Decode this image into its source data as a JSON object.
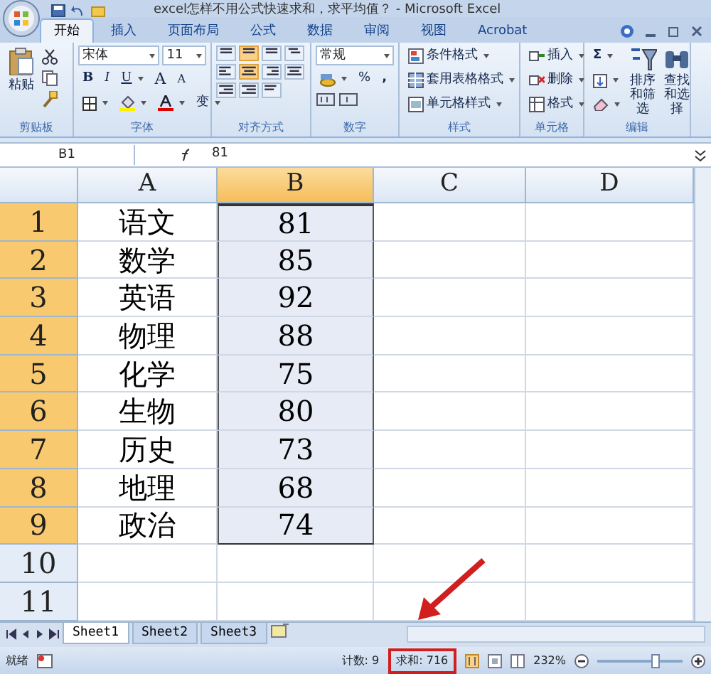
{
  "window": {
    "title": "excel怎样不用公式快速求和，求平均值？ - Microsoft Excel"
  },
  "ribbon_tabs": [
    {
      "label": "开始",
      "selected": true
    },
    {
      "label": "插入",
      "selected": false
    },
    {
      "label": "页面布局",
      "selected": false
    },
    {
      "label": "公式",
      "selected": false
    },
    {
      "label": "数据",
      "selected": false
    },
    {
      "label": "审阅",
      "selected": false
    },
    {
      "label": "视图",
      "selected": false
    },
    {
      "label": "Acrobat",
      "selected": false
    }
  ],
  "ribbon": {
    "clipboard": {
      "label": "剪贴板",
      "paste": "粘贴"
    },
    "font": {
      "label": "字体",
      "font_name": "宋体",
      "font_size": "11",
      "bold": "B",
      "italic": "I",
      "underline": "U",
      "grow": "A",
      "shrink": "A",
      "phonetic": "变"
    },
    "alignment": {
      "label": "对齐方式"
    },
    "number": {
      "label": "数字",
      "format": "常规",
      "percent": "%",
      "comma": ","
    },
    "styles": {
      "label": "样式",
      "commands": [
        "条件格式",
        "套用表格格式",
        "单元格样式"
      ]
    },
    "cells": {
      "label": "单元格",
      "commands": [
        "插入",
        "删除",
        "格式"
      ]
    },
    "editing": {
      "label": "编辑",
      "sum": "Σ",
      "commands": [
        "排序和筛选",
        "查找和选择"
      ]
    }
  },
  "formula_bar": {
    "name_box": "B1",
    "formula": "81"
  },
  "columns": [
    {
      "label": "A",
      "selected": false
    },
    {
      "label": "B",
      "selected": true
    },
    {
      "label": "C",
      "selected": false
    },
    {
      "label": "D",
      "selected": false
    }
  ],
  "rows": [
    {
      "number": "1",
      "selected": true,
      "cells": [
        "语文",
        "81"
      ]
    },
    {
      "number": "2",
      "selected": true,
      "cells": [
        "数学",
        "85"
      ]
    },
    {
      "number": "3",
      "selected": true,
      "cells": [
        "英语",
        "92"
      ]
    },
    {
      "number": "4",
      "selected": true,
      "cells": [
        "物理",
        "88"
      ]
    },
    {
      "number": "5",
      "selected": true,
      "cells": [
        "化学",
        "75"
      ]
    },
    {
      "number": "6",
      "selected": true,
      "cells": [
        "生物",
        "80"
      ]
    },
    {
      "number": "7",
      "selected": true,
      "cells": [
        "历史",
        "73"
      ]
    },
    {
      "number": "8",
      "selected": true,
      "cells": [
        "地理",
        "68"
      ]
    },
    {
      "number": "9",
      "selected": true,
      "cells": [
        "政治",
        "74"
      ]
    },
    {
      "number": "10",
      "selected": false
    },
    {
      "number": "11",
      "selected": false
    }
  ],
  "sheet_tabs": [
    {
      "label": "Sheet1",
      "selected": true
    },
    {
      "label": "Sheet2",
      "selected": false
    },
    {
      "label": "Sheet3",
      "selected": false
    }
  ],
  "status_bar": {
    "mode": "就绪",
    "count": "计数: 9",
    "sum": "求和: 716",
    "sum_highlighted": true,
    "zoom": "232%",
    "zoom_slider": {
      "level": 0.68
    }
  }
}
